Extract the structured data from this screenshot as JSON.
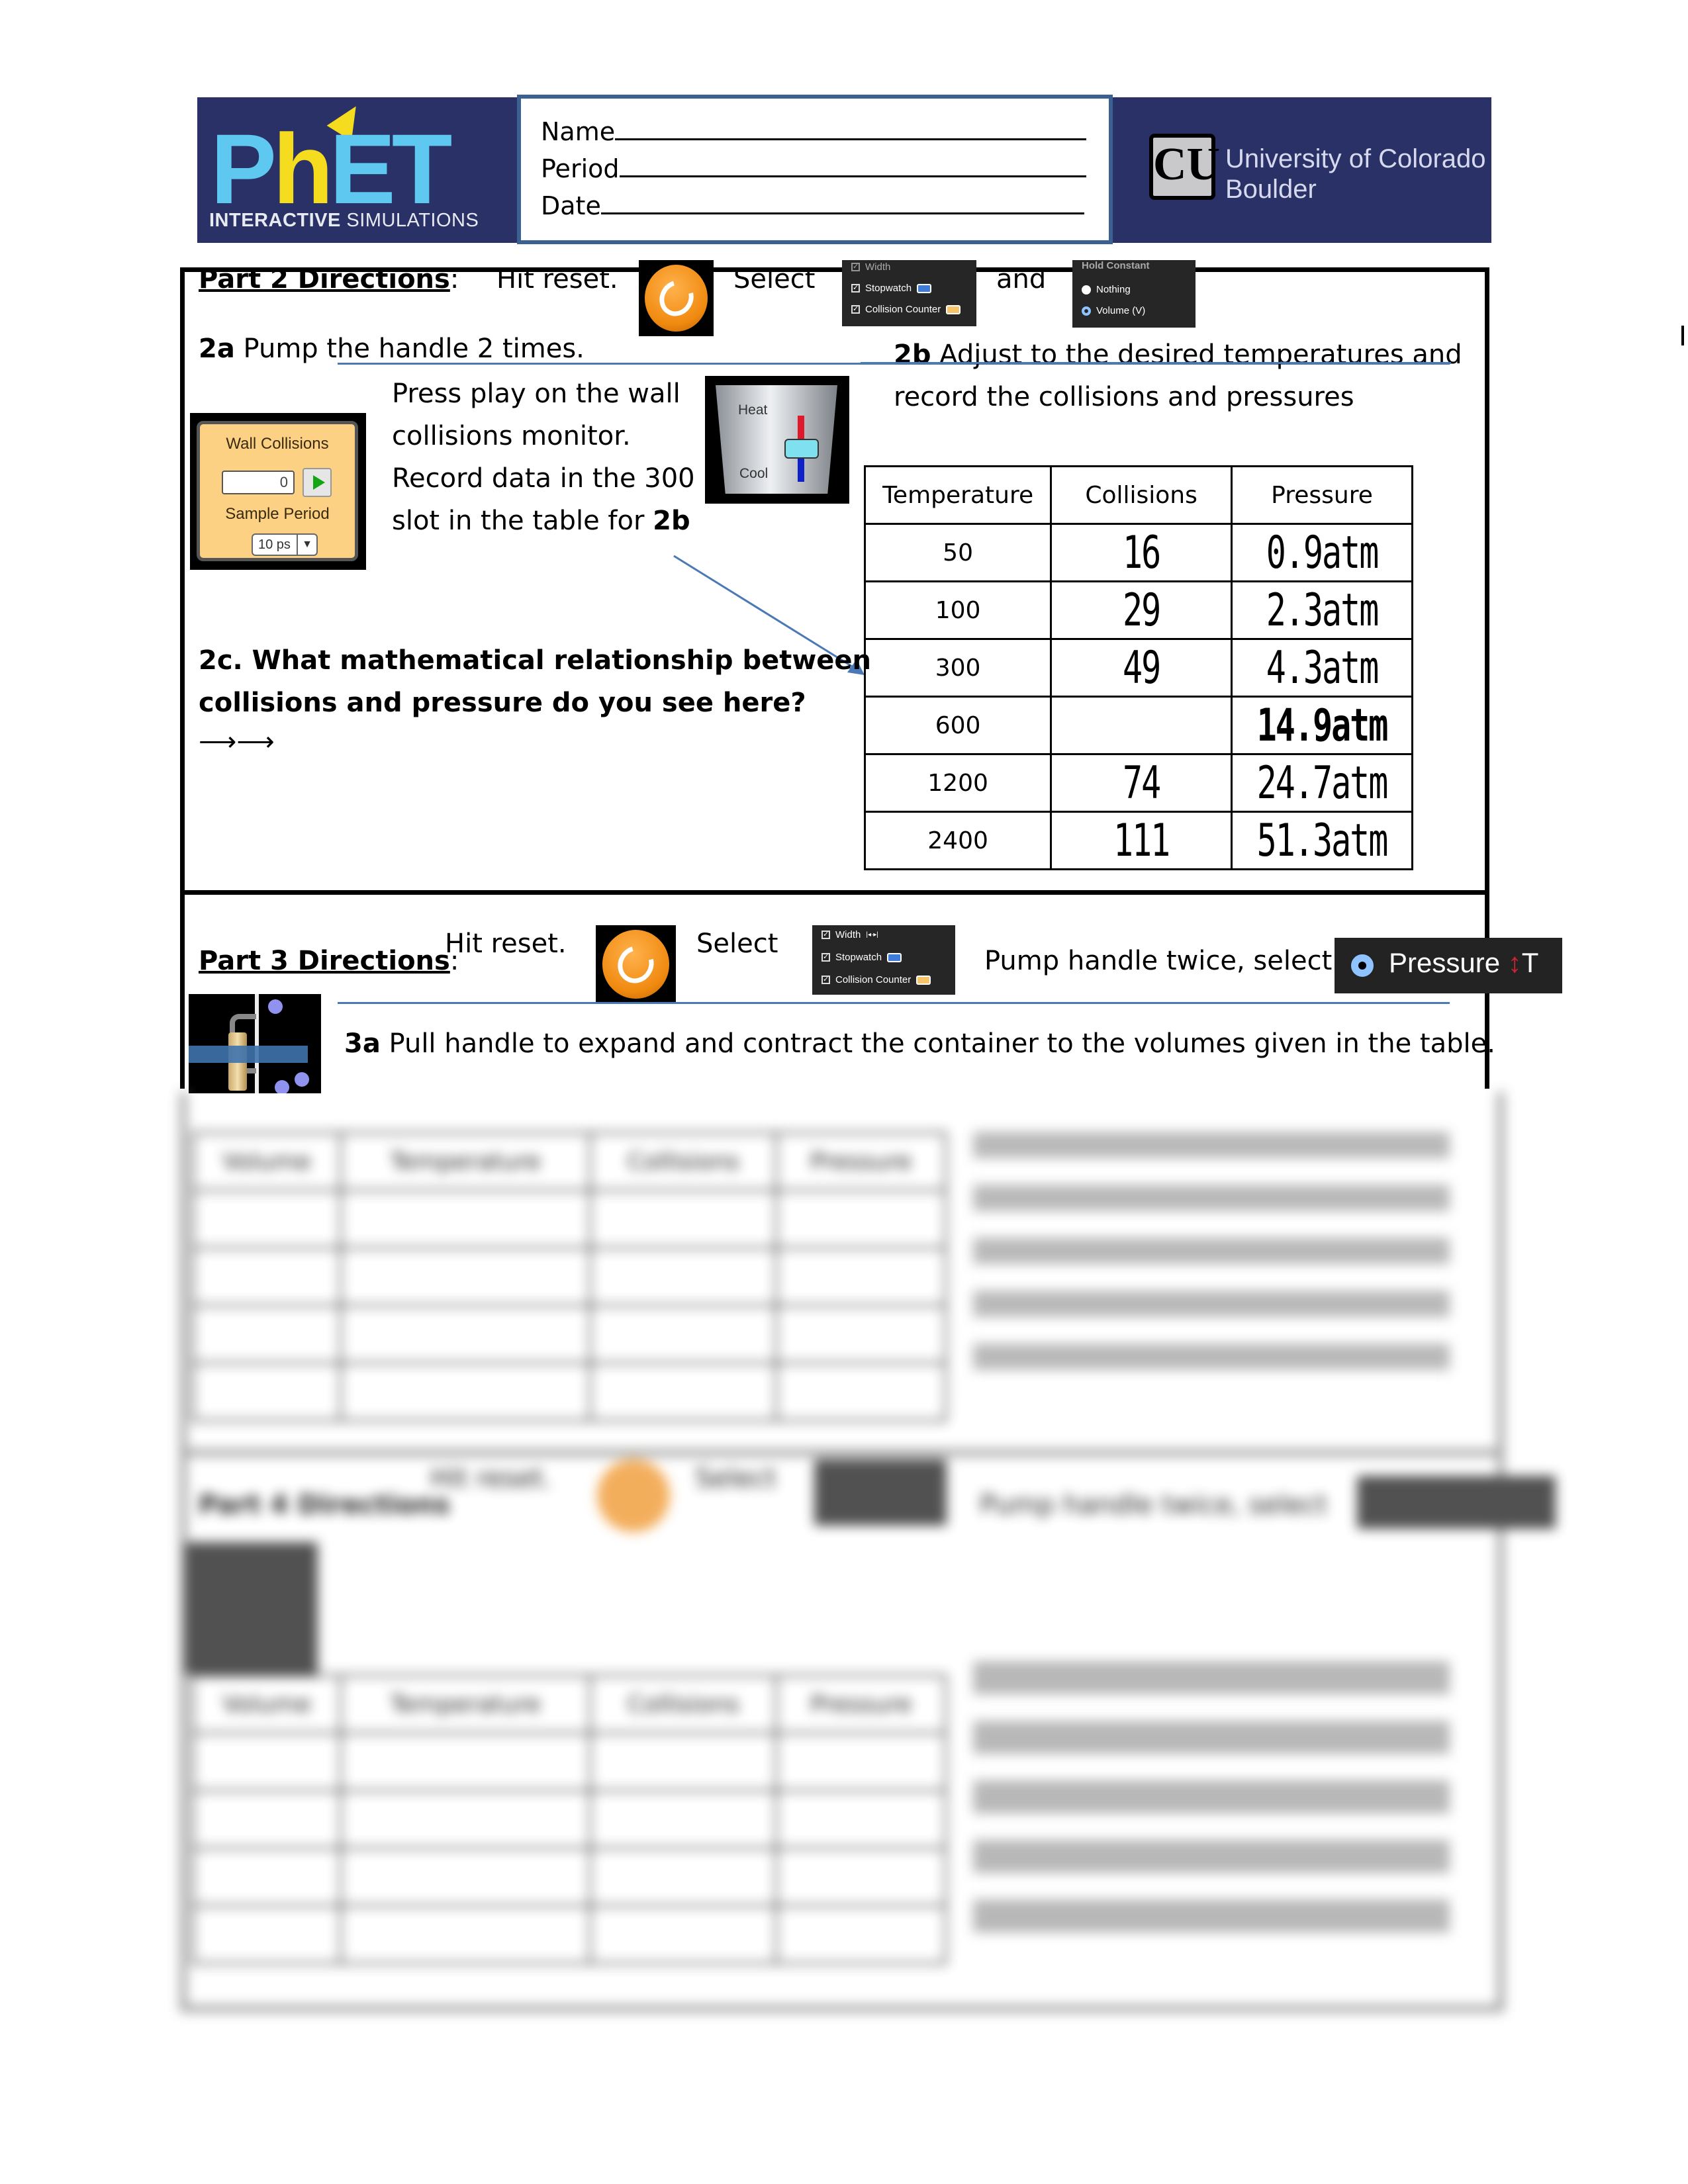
{
  "header": {
    "phet_logo": {
      "letters": [
        "P",
        "h",
        "ET"
      ],
      "subtitle_bold": "INTERACTIVE",
      "subtitle_rest": " SIMULATIONS",
      "registered_mark": "®"
    },
    "student_fields": [
      {
        "label": "Name",
        "value": ""
      },
      {
        "label": "Period",
        "value": ""
      },
      {
        "label": "Date",
        "value": ""
      }
    ],
    "university": {
      "mark": "CU",
      "line1": "University of Colorado",
      "line2": "Boulder"
    }
  },
  "part2": {
    "title": "Part 2 Directions",
    "title_suffix": ":",
    "hit_reset": "Hit reset.",
    "select": "Select",
    "and": "and",
    "options_panel": {
      "items": [
        {
          "label": "Width",
          "checked": true,
          "clipped": true
        },
        {
          "label": "Stopwatch",
          "checked": true,
          "swatch_color": "#3f7bd8"
        },
        {
          "label": "Collision Counter",
          "checked": true,
          "swatch_color": "#f6c46a"
        }
      ]
    },
    "hold_constant_panel": {
      "title": "Hold Constant",
      "options": [
        {
          "label": "Nothing",
          "selected": false
        },
        {
          "label": "Volume (V)",
          "selected": true
        }
      ]
    },
    "q2a_label": "2a",
    "q2a_text": " Pump the handle 2 times.",
    "monitor_text": [
      "Press play on the wall",
      "collisions monitor.",
      "Record data in the 300"
    ],
    "monitor_text_last": "slot in the table for ",
    "monitor_text_last_bold": "2b",
    "wall_collisions": {
      "title": "Wall Collisions",
      "count": "0",
      "sample_period_label": "Sample Period",
      "sample_period_value": "10 ps"
    },
    "heater": {
      "heat_label": "Heat",
      "cool_label": "Cool"
    },
    "q2b_label": "2b",
    "q2b_text": " Adjust to the desired temperatures and",
    "q2b_text2": "record the collisions and pressures",
    "table": {
      "headers": [
        "Temperature",
        "Collisions",
        "Pressure"
      ],
      "rows": [
        {
          "temperature": "50",
          "collisions": "16",
          "pressure": "0.9atm"
        },
        {
          "temperature": "100",
          "collisions": "29",
          "pressure": "2.3atm"
        },
        {
          "temperature": "300",
          "collisions": "49",
          "pressure": "4.3atm"
        },
        {
          "temperature": "600",
          "collisions": "",
          "pressure": "14.9atm"
        },
        {
          "temperature": "1200",
          "collisions": "74",
          "pressure": "24.7atm"
        },
        {
          "temperature": "2400",
          "collisions": "111",
          "pressure": "51.3atm"
        }
      ]
    },
    "q2c_text": [
      "2c. What mathematical relationship between",
      "collisions and pressure do you see here?"
    ],
    "q2c_arrows": "⟶⟶"
  },
  "part3": {
    "title": "Part 3 Directions",
    "title_suffix": ":",
    "hit_reset": "Hit reset.",
    "select": "Select",
    "options_panel": {
      "items": [
        {
          "label": "Width",
          "checked": true
        },
        {
          "label": "Stopwatch",
          "checked": true,
          "swatch_color": "#3f7bd8"
        },
        {
          "label": "Collision Counter",
          "checked": true,
          "swatch_color": "#f6c46a"
        }
      ]
    },
    "pump_text": "Pump handle twice, select",
    "pressure_option": {
      "label": "Pressure",
      "arrow": "↕",
      "suffix": "T",
      "selected": true
    },
    "q3a_label": "3a",
    "q3a_text": " Pull handle to expand and contract the container to the volumes given in the table."
  },
  "blurred_preview": {
    "part3_table_headers": [
      "Volume",
      "Temperature",
      "Collisions",
      "Pressure"
    ],
    "part3_table_rows": 5,
    "part4_title": "Part 4 Directions",
    "part4_hit_reset": "Hit reset.",
    "part4_select": "Select",
    "part4_pump_text": "Pump handle twice, select",
    "part4_table_headers": [
      "Volume",
      "Temperature",
      "Collisions",
      "Pressure"
    ],
    "part4_table_rows": 5
  }
}
